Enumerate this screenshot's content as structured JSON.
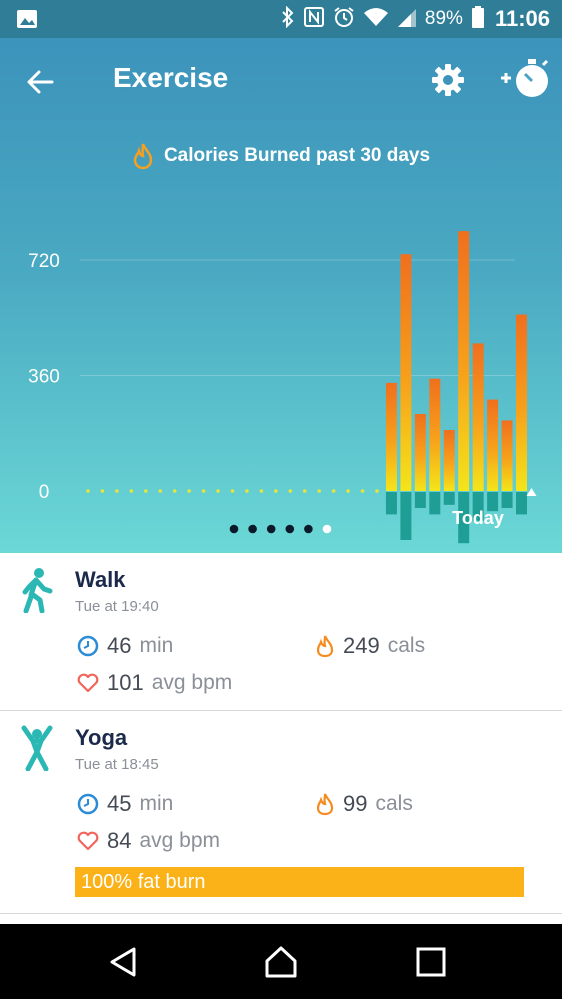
{
  "status_bar": {
    "battery": "89%",
    "time": "11:06",
    "icons": [
      "gallery-icon",
      "bluetooth-icon",
      "nfc-icon",
      "alarm-icon",
      "wifi-icon",
      "signal-icon",
      "battery-icon"
    ]
  },
  "header": {
    "title": "Exercise",
    "chart_caption": "Calories Burned past 30 days"
  },
  "chart_data": {
    "type": "bar",
    "title": "Calories Burned past 30 days",
    "y_ticks": [
      "720",
      "360",
      "0"
    ],
    "ylim": [
      0,
      800
    ],
    "x_label_last": "Today",
    "grid": true,
    "values": [
      0,
      0,
      0,
      0,
      0,
      0,
      0,
      0,
      0,
      0,
      0,
      0,
      0,
      0,
      0,
      0,
      0,
      0,
      0,
      0,
      0,
      337,
      738,
      240,
      350,
      190,
      810,
      460,
      285,
      220,
      550
    ],
    "below_values": [
      0,
      0,
      0,
      0,
      0,
      0,
      0,
      0,
      0,
      0,
      0,
      0,
      0,
      0,
      0,
      0,
      0,
      0,
      0,
      0,
      0,
      70,
      150,
      50,
      70,
      40,
      160,
      90,
      60,
      50,
      70
    ],
    "pager": {
      "count": 6,
      "active": 5
    },
    "colors": {
      "top": "#f06f1e",
      "bottom": "#f4e51a",
      "below": "#1f9e96",
      "dots": "#e6e63a"
    }
  },
  "exercises": [
    {
      "name": "Walk",
      "time": "Tue at 19:40",
      "duration_value": "46",
      "duration_unit": "min",
      "cals_value": "249",
      "cals_unit": "cals",
      "bpm_value": "101",
      "bpm_unit": "avg bpm",
      "icon": "walk-icon"
    },
    {
      "name": "Yoga",
      "time": "Tue at 18:45",
      "duration_value": "45",
      "duration_unit": "min",
      "cals_value": "99",
      "cals_unit": "cals",
      "bpm_value": "84",
      "bpm_unit": "avg bpm",
      "fat_burn": "100% fat burn",
      "icon": "yoga-icon"
    }
  ],
  "nav_bar": {
    "buttons": [
      "back-triangle-icon",
      "home-icon",
      "recents-icon"
    ]
  },
  "colors": {
    "accent": "#2bb7b3",
    "fat_burn": "#fbb118",
    "flame": "#f68b1f",
    "heart": "#f0665c",
    "clock": "#2a8bd6"
  }
}
